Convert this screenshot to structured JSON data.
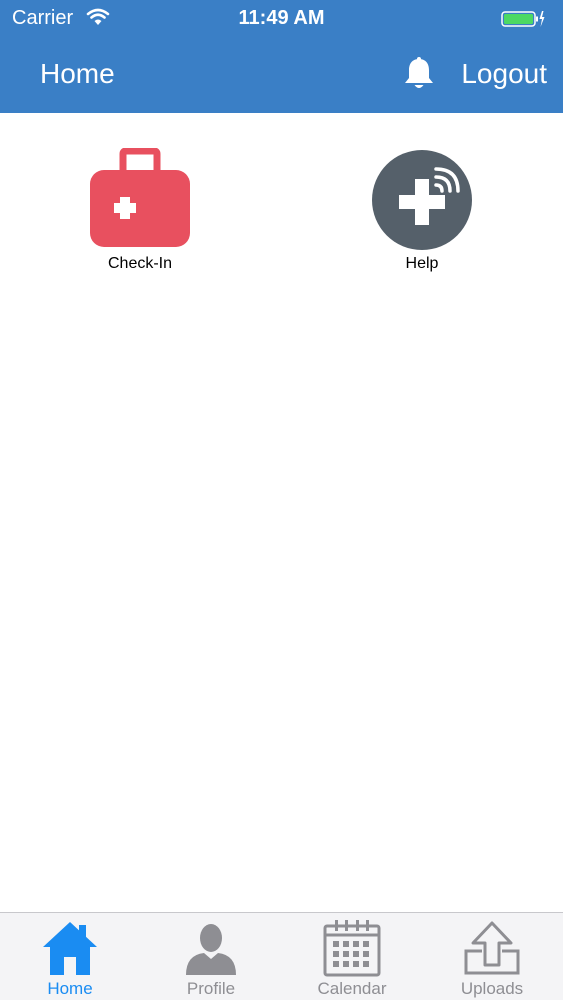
{
  "status_bar": {
    "carrier": "Carrier",
    "time": "11:49 AM"
  },
  "nav": {
    "title": "Home",
    "logout_label": "Logout"
  },
  "tiles": [
    {
      "label": "Check-In",
      "icon": "first-aid-kit-icon",
      "color": "#e8505f"
    },
    {
      "label": "Help",
      "icon": "help-cross-signal-icon",
      "color": "#55606a"
    }
  ],
  "tabs": [
    {
      "label": "Home",
      "icon": "house-icon",
      "active": true
    },
    {
      "label": "Profile",
      "icon": "person-icon",
      "active": false
    },
    {
      "label": "Calendar",
      "icon": "calendar-icon",
      "active": false
    },
    {
      "label": "Uploads",
      "icon": "upload-icon",
      "active": false
    }
  ],
  "colors": {
    "header": "#3a7fc6",
    "tab_active": "#1a8cf2",
    "tab_inactive": "#8e8e93",
    "battery": "#4cd964"
  }
}
